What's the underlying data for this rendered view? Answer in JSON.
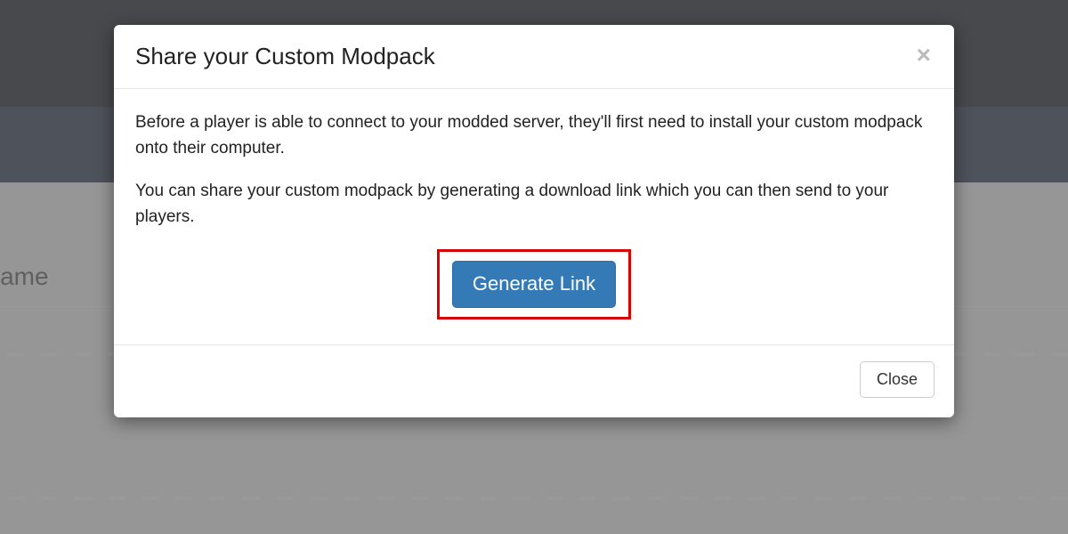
{
  "background": {
    "partial_text": "and game"
  },
  "modal": {
    "title": "Share your Custom Modpack",
    "paragraph1": "Before a player is able to connect to your modded server, they'll first need to install your custom modpack onto their computer.",
    "paragraph2": "You can share your custom modpack by generating a download link which you can then send to your players.",
    "generate_button": "Generate Link",
    "close_button": "Close",
    "close_icon": "×"
  }
}
